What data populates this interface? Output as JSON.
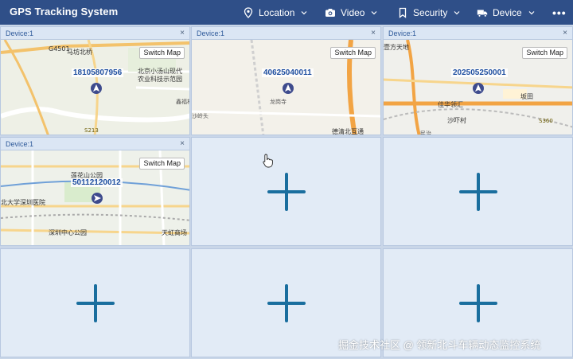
{
  "app": {
    "title": "GPS Tracking System"
  },
  "nav": [
    {
      "label": "Location"
    },
    {
      "label": "Video"
    },
    {
      "label": "Security"
    },
    {
      "label": "Device"
    },
    {
      "label": "•••"
    }
  ],
  "cells": [
    {
      "header": "Device:1",
      "close": "×",
      "switch": "Switch Map",
      "device_id": "18105807956",
      "map_labels": [
        "G4501",
        "马坊北桥",
        "北京小汤山现代",
        "农业科技示范园",
        "S213",
        "鑫福村"
      ]
    },
    {
      "header": "Device:1",
      "close": "×",
      "switch": "Switch Map",
      "device_id": "40625040011",
      "map_labels": [
        "龙岗寺",
        "沙岭头",
        "德清北互通"
      ]
    },
    {
      "header": "Device:1",
      "close": "×",
      "switch": "Switch Map",
      "device_id": "202505250001",
      "map_labels": [
        "壹方天地",
        "坂田",
        "佳华领汇",
        "沙吓村",
        "S360",
        "民治"
      ]
    },
    {
      "header": "Device:1",
      "close": "×",
      "switch": "Switch Map",
      "device_id": "50112120012",
      "map_labels": [
        "莲花山公园",
        "北大学深圳医院",
        "深圳中心公园",
        "天虹商场"
      ]
    }
  ],
  "watermark": "掘金技术社区 @ 领新北斗车辆动态监控系统",
  "colors": {
    "header": "#2f4f88",
    "accent": "#1a6e9e",
    "device_text": "#1f4fa0"
  }
}
